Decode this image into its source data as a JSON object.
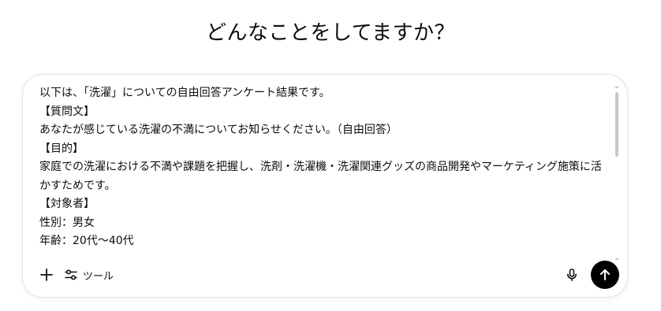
{
  "heading": "どんなことをしてますか？",
  "composer": {
    "lines": [
      "以下は、「洗濯」についての自由回答アンケート結果です。",
      "【質問文】",
      "あなたが感じている洗濯の不満についてお知らせください。（自由回答）",
      "【目的】",
      "家庭での洗濯における不満や課題を把握し、洗剤・洗濯機・洗濯関連グッズの商品開発やマーケティング施策に活",
      "かすためです。",
      "【対象者】",
      "性別：男女",
      "年齢：20代〜40代"
    ]
  },
  "toolbar": {
    "add_icon": "plus-icon",
    "tools_icon": "sliders-icon",
    "tools_label": "ツール",
    "mic_icon": "microphone-icon",
    "send_icon": "arrow-up-icon"
  },
  "colors": {
    "send_button_bg": "#000000",
    "border": "#e3e3e3",
    "text": "#0d0d0d"
  }
}
